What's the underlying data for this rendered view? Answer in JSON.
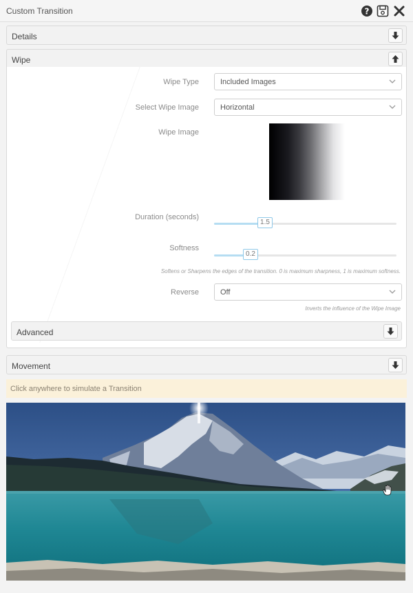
{
  "window": {
    "title": "Custom Transition"
  },
  "titlebar_icons": [
    "help-icon",
    "save-icon",
    "close-icon"
  ],
  "sections": {
    "details": {
      "label": "Details",
      "state": "collapsed"
    },
    "wipe": {
      "label": "Wipe",
      "state": "expanded"
    },
    "advanced": {
      "label": "Advanced",
      "state": "collapsed"
    },
    "movement": {
      "label": "Movement",
      "state": "collapsed"
    }
  },
  "wipe": {
    "wipe_type": {
      "label": "Wipe Type",
      "value": "Included Images"
    },
    "select_wipe_image": {
      "label": "Select Wipe Image",
      "value": "Horizontal"
    },
    "wipe_image": {
      "label": "Wipe Image"
    },
    "duration": {
      "label": "Duration (seconds)",
      "value": "1.5",
      "fraction": 0.28
    },
    "softness": {
      "label": "Softness",
      "value": "0.2",
      "fraction": 0.2,
      "hint": "Softens or Sharpens the edges of the transition. 0 is maximum sharpness, 1 is maximum softness."
    },
    "reverse": {
      "label": "Reverse",
      "value": "Off",
      "hint": "Inverts the influence of the Wipe Image"
    }
  },
  "notice": {
    "text": "Click anywhere to simulate a Transition"
  },
  "colors": {
    "accent": "#8fc8e8",
    "slider_fill": "#b5ddf2",
    "notice_bg": "#fbf1da",
    "panel_bg": "#f2f2f2"
  }
}
